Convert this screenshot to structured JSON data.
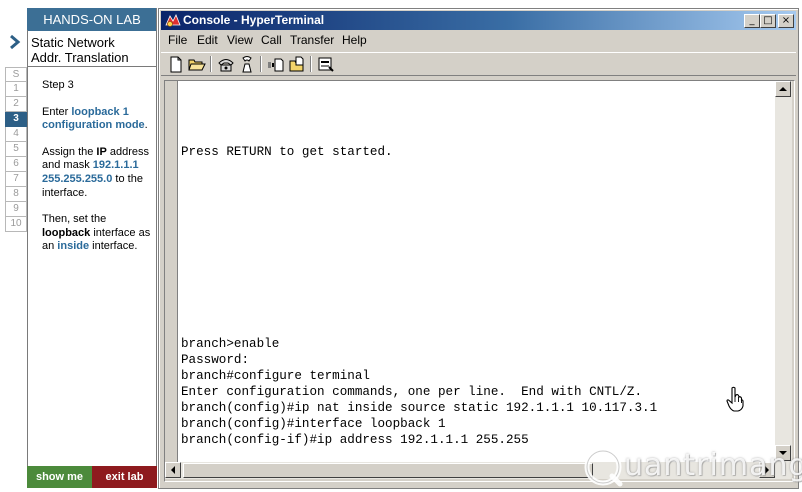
{
  "lab": {
    "header": "HANDS-ON LAB",
    "title_line1": "Static Network",
    "title_line2": "Addr. Translation",
    "steps": [
      "S",
      "1",
      "2",
      "3",
      "4",
      "5",
      "6",
      "7",
      "8",
      "9",
      "10"
    ],
    "active_step": "3",
    "step_label": "Step 3",
    "p1": {
      "a": "Enter ",
      "b": "loopback 1 configuration mode",
      "c": "."
    },
    "p2": {
      "a": "Assign the ",
      "b": "IP",
      "c": " address and mask ",
      "d": "192.1.1.1 255.255.255.0",
      "e": " to the interface."
    },
    "p3": {
      "a": "Then, set the ",
      "b": "loopback",
      "c": " interface as an ",
      "d": "inside",
      "e": " interface."
    },
    "show_me": "show me",
    "exit_lab": "exit lab",
    "colors": {
      "header": "#3c6f95",
      "active_step": "#2d5f86",
      "show_me": "#4c8a3b",
      "exit_lab": "#8e1a1e",
      "highlight": "#2a6a9a"
    }
  },
  "window": {
    "title": "Console - HyperTerminal",
    "controls": {
      "minimize": "_",
      "maximize": "□",
      "close": "×"
    },
    "menu": [
      "File",
      "Edit",
      "View",
      "Call",
      "Transfer",
      "Help"
    ],
    "toolbar_icons": [
      "new-icon",
      "open-icon",
      "call-icon",
      "disconnect-icon",
      "send-icon",
      "receive-icon",
      "properties-icon"
    ],
    "terminal_lines": [
      "Press RETURN to get started.",
      "branch>enable",
      "Password:",
      "branch#configure terminal",
      "Enter configuration commands, one per line.  End with CNTL/Z.",
      "branch(config)#ip nat inside source static 192.1.1.1 10.117.3.1",
      "branch(config)#interface loopback 1",
      "branch(config-if)#ip address 192.1.1.1 255.255"
    ]
  },
  "watermark": "uantrimang"
}
